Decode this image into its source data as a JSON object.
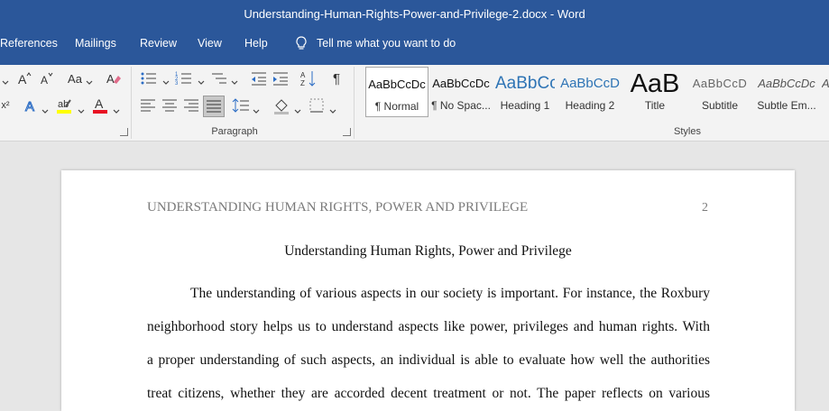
{
  "window": {
    "title": "Understanding-Human-Rights-Power-and-Privilege-2.docx  -  Word"
  },
  "tabs": [
    "References",
    "Mailings",
    "Review",
    "View",
    "Help"
  ],
  "tellme": {
    "label": "Tell me what you want to do"
  },
  "ribbon": {
    "paragraph_label": "Paragraph",
    "styles_label": "Styles",
    "font_case_label": "Aa",
    "styles": [
      {
        "sample": "AaBbCcDc",
        "name": "¶ Normal"
      },
      {
        "sample": "AaBbCcDc",
        "name": "¶ No Spac..."
      },
      {
        "sample": "AaBbCc",
        "name": "Heading 1"
      },
      {
        "sample": "AaBbCcD",
        "name": "Heading 2"
      },
      {
        "sample": "AaB",
        "name": "Title"
      },
      {
        "sample": "AaBbCcD",
        "name": "Subtitle"
      },
      {
        "sample": "AaBbCcDc",
        "name": "Subtle Em..."
      }
    ],
    "icons": [
      "font-grow-icon",
      "font-shrink-icon",
      "change-case-icon",
      "clear-formatting-icon",
      "text-effects-icon",
      "highlight-icon",
      "font-color-icon",
      "bullets-icon",
      "numbering-icon",
      "multilevel-list-icon",
      "decrease-indent-icon",
      "increase-indent-icon",
      "sort-icon",
      "show-marks-icon",
      "align-left-icon",
      "align-center-icon",
      "align-right-icon",
      "justify-icon",
      "line-spacing-icon",
      "shading-icon",
      "borders-icon",
      "lightbulb-icon"
    ],
    "colors": {
      "titlebar": "#2b579a",
      "highlight": "#ffff00",
      "font_color": "#e81123"
    }
  },
  "document": {
    "header_text": "UNDERSTANDING HUMAN RIGHTS, POWER AND PRIVILEGE",
    "page_number": "2",
    "title": "Understanding Human Rights, Power and Privilege",
    "lines": [
      "The understanding of various aspects in our society is important. For instance, the Roxbury",
      "neighborhood story helps us to understand aspects like power, privileges and human rights. With",
      "a proper understanding of such aspects, an individual is able to evaluate how well the authorities",
      "treat citizens, whether they are accorded decent treatment or not. The paper reflects on various"
    ]
  }
}
